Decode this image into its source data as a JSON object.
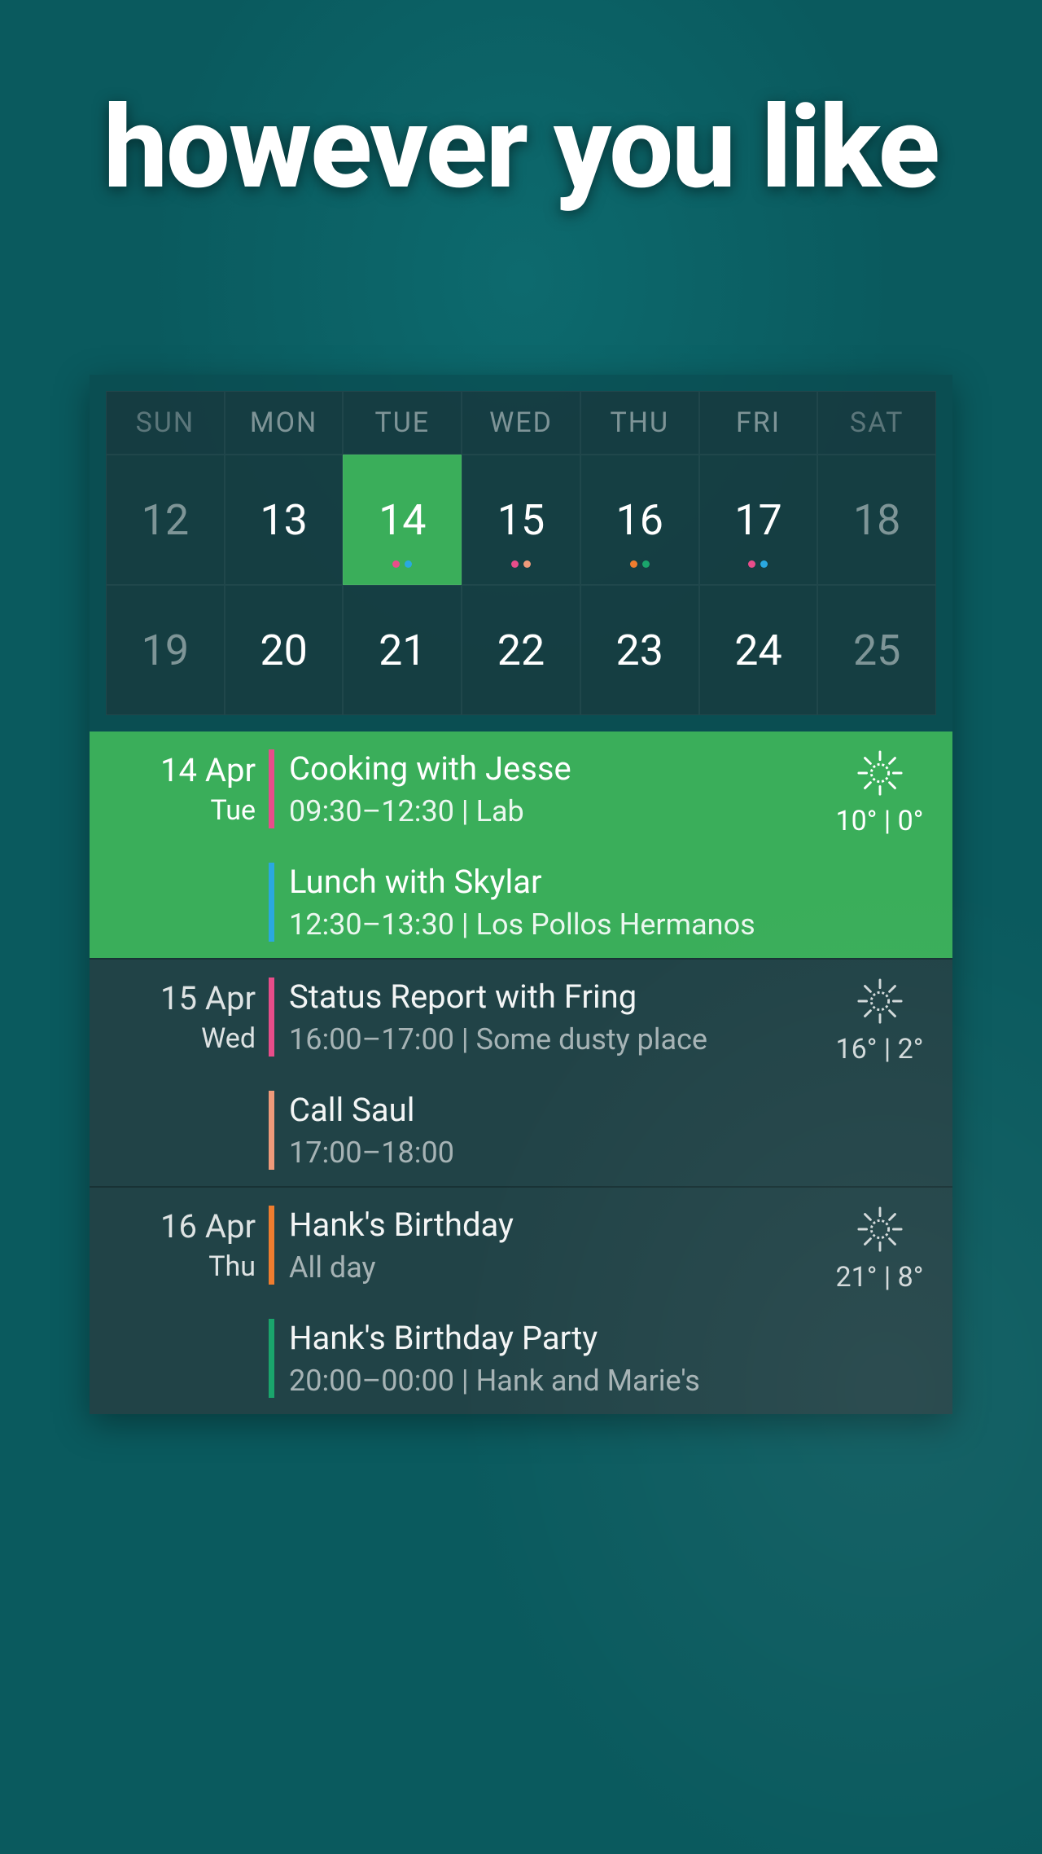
{
  "headline": "however you like",
  "dot_colors": {
    "pink": "#e84d8a",
    "blue": "#2aa8e0",
    "green": "#1aa56c",
    "orange": "#ef7d2f",
    "salmon": "#ef9a7a"
  },
  "calendar": {
    "day_headers": [
      "SUN",
      "MON",
      "TUE",
      "WED",
      "THU",
      "FRI",
      "SAT"
    ],
    "weekend_indices": [
      0,
      6
    ],
    "rows": [
      [
        {
          "n": "12",
          "weekend": true
        },
        {
          "n": "13"
        },
        {
          "n": "14",
          "today": true,
          "dots": [
            "pink",
            "blue"
          ]
        },
        {
          "n": "15",
          "dots": [
            "pink",
            "salmon"
          ]
        },
        {
          "n": "16",
          "dots": [
            "orange",
            "green"
          ]
        },
        {
          "n": "17",
          "dots": [
            "pink",
            "blue"
          ]
        },
        {
          "n": "18",
          "weekend": true
        }
      ],
      [
        {
          "n": "19",
          "weekend": true
        },
        {
          "n": "20"
        },
        {
          "n": "21"
        },
        {
          "n": "22"
        },
        {
          "n": "23"
        },
        {
          "n": "24"
        },
        {
          "n": "25",
          "weekend": true
        }
      ]
    ]
  },
  "agenda": [
    {
      "date": "14 Apr",
      "dow": "Tue",
      "today": true,
      "weather": {
        "icon": "sun",
        "temp": "10° | 0°"
      },
      "events": [
        {
          "color": "pink",
          "title": "Cooking with Jesse",
          "sub": "09:30–12:30  |  Lab"
        },
        {
          "color": "blue",
          "title": "Lunch with Skylar",
          "sub": "12:30–13:30  |  Los Pollos Hermanos"
        }
      ]
    },
    {
      "date": "15 Apr",
      "dow": "Wed",
      "today": false,
      "weather": {
        "icon": "sun",
        "temp": "16° | 2°"
      },
      "events": [
        {
          "color": "pink",
          "title": "Status Report with Fring",
          "sub": "16:00–17:00  |  Some dusty place"
        },
        {
          "color": "salmon",
          "title": "Call Saul",
          "sub": "17:00–18:00"
        }
      ]
    },
    {
      "date": "16 Apr",
      "dow": "Thu",
      "today": false,
      "weather": {
        "icon": "sun",
        "temp": "21° | 8°"
      },
      "events": [
        {
          "color": "orange",
          "title": "Hank's Birthday",
          "sub": "All day"
        },
        {
          "color": "green",
          "title": "Hank's Birthday Party",
          "sub": "20:00–00:00  |  Hank and Marie's"
        }
      ]
    }
  ]
}
